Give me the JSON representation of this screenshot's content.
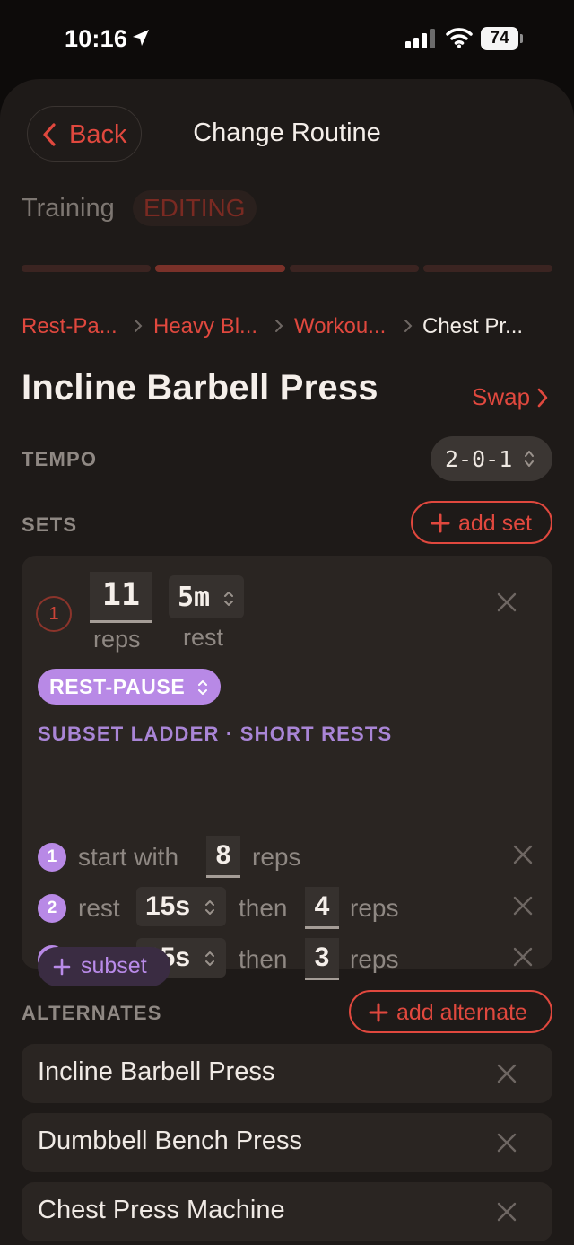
{
  "status": {
    "time": "10:16",
    "battery": "74"
  },
  "nav": {
    "back_label": "Back",
    "title": "Change Routine"
  },
  "mode": {
    "training_label": "Training",
    "editing_label": "EDITING"
  },
  "progress": {
    "segments": 4,
    "active_segment": 2
  },
  "breadcrumbs": [
    "Rest-Pa...",
    "Heavy Bl...",
    "Workou...",
    "Chest Pr..."
  ],
  "exercise": {
    "name": "Incline Barbell Press",
    "swap_label": "Swap"
  },
  "tempo": {
    "label": "TEMPO",
    "value": "2-0-1"
  },
  "sets_section": {
    "label": "SETS",
    "add_label": "add set"
  },
  "set": {
    "number": "1",
    "reps": "11",
    "reps_label": "reps",
    "rest": "5m",
    "rest_label": "rest",
    "type": "REST-PAUSE",
    "ladder_title": "SUBSET LADDER · SHORT RESTS",
    "subsets": [
      {
        "number": "1",
        "start_label": "start with",
        "reps": "8",
        "reps_label": "reps"
      },
      {
        "number": "2",
        "rest_label": "rest",
        "rest": "15s",
        "then_label": "then",
        "reps": "4",
        "reps_label": "reps"
      },
      {
        "number": "3",
        "rest_label": "rest",
        "rest": "15s",
        "then_label": "then",
        "reps": "3",
        "reps_label": "reps"
      }
    ],
    "add_subset_label": "subset"
  },
  "alternates_section": {
    "label": "ALTERNATES",
    "add_label": "add alternate"
  },
  "alternates": [
    "Incline Barbell Press",
    "Dumbbell Bench Press",
    "Chest Press Machine"
  ],
  "colors": {
    "accent": "#e0483e",
    "purple": "#b889e6",
    "sheet": "#1e1a18",
    "card": "#2a2522"
  }
}
